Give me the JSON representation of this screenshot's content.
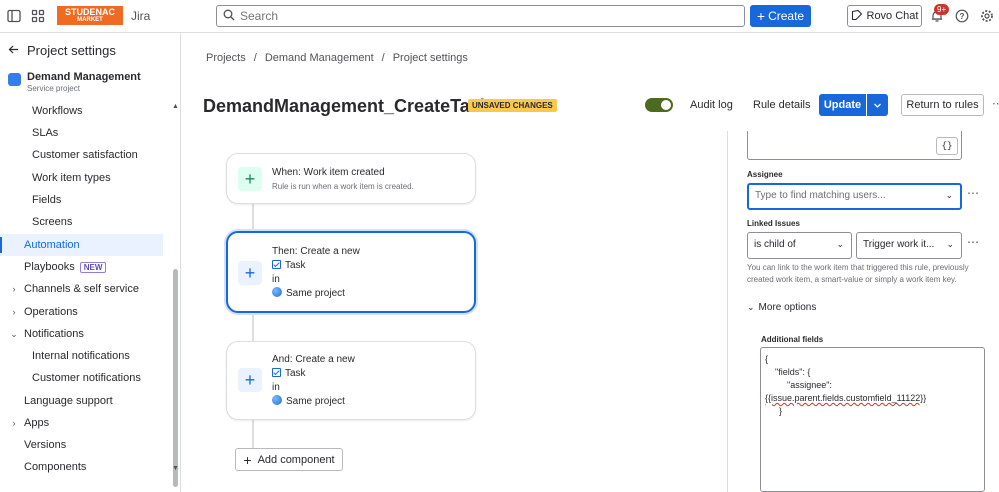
{
  "topbar": {
    "logo_line1": "STUDENAC",
    "logo_line2": "MARKET",
    "app_name": "Jira",
    "search_placeholder": "Search",
    "create_label": "Create",
    "rovo_label": "Rovo Chat",
    "notification_count": "9+",
    "icons": [
      "sidebar-toggle-icon",
      "app-switcher-icon",
      "search-icon",
      "bell-icon",
      "help-icon",
      "settings-icon"
    ]
  },
  "sidebar": {
    "back_label": "Project settings",
    "project_name": "Demand Management",
    "project_type": "Service project",
    "items": [
      {
        "label": "Workflows"
      },
      {
        "label": "SLAs"
      },
      {
        "label": "Customer satisfaction"
      },
      {
        "label": "Work item types"
      },
      {
        "label": "Fields"
      },
      {
        "label": "Screens"
      },
      {
        "label": "Automation"
      },
      {
        "label": "Playbooks",
        "tag": "NEW"
      },
      {
        "label": "Channels & self service"
      },
      {
        "label": "Operations"
      },
      {
        "label": "Notifications"
      },
      {
        "label": "Internal notifications"
      },
      {
        "label": "Customer notifications"
      },
      {
        "label": "Language support"
      },
      {
        "label": "Apps"
      },
      {
        "label": "Versions"
      },
      {
        "label": "Components"
      }
    ]
  },
  "breadcrumb": [
    "Projects",
    "/",
    "Demand Management",
    "/",
    "Project settings"
  ],
  "header": {
    "title": "DemandManagement_CreateTask",
    "unsaved_badge": "UNSAVED CHANGES",
    "audit_log": "Audit log",
    "rule_details": "Rule details",
    "update_label": "Update",
    "return_label": "Return to rules",
    "toggle_on": true
  },
  "flow": {
    "trigger": {
      "title": "When: Work item created",
      "subtitle": "Rule is run when a work item is created."
    },
    "action1": {
      "title": "Then: Create a new",
      "type": "Task",
      "in": "in",
      "project": "Same project"
    },
    "action2": {
      "title": "And: Create a new",
      "type": "Task",
      "in": "in",
      "project": "Same project"
    },
    "add_component": "Add component"
  },
  "panel": {
    "assignee_label": "Assignee",
    "assignee_placeholder": "Type to find matching users...",
    "linked_label": "Linked Issues",
    "link_type": "is child of",
    "link_target": "Trigger work it...",
    "helper": "You can link to the work item that triggered this rule, previously created work item, a smart-value or simply a work item key.",
    "more_options": "More options",
    "additional_label": "Additional fields",
    "additional_lines": [
      "{",
      "\"fields\": {",
      "\"assignee\":",
      "{{issue.parent.fields.customfield_11122}}",
      "}"
    ]
  }
}
